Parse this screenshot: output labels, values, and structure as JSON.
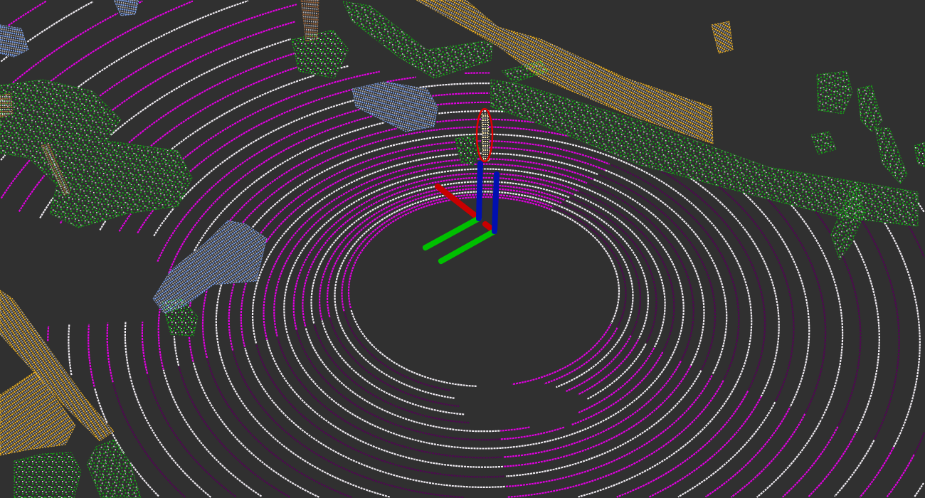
{
  "point_classes": [
    {
      "kind": "road",
      "color": "#e100e1"
    },
    {
      "kind": "sidewalk",
      "color": "#4e0a50"
    },
    {
      "kind": "vegetation",
      "color": "#14a814"
    },
    {
      "kind": "building",
      "color": "#f7b620"
    },
    {
      "kind": "vehicle",
      "color": "#7ea4f2"
    },
    {
      "kind": "trunk",
      "color": "#9c6438"
    },
    {
      "kind": "pole",
      "color": "#f2e2a8"
    }
  ]
}
